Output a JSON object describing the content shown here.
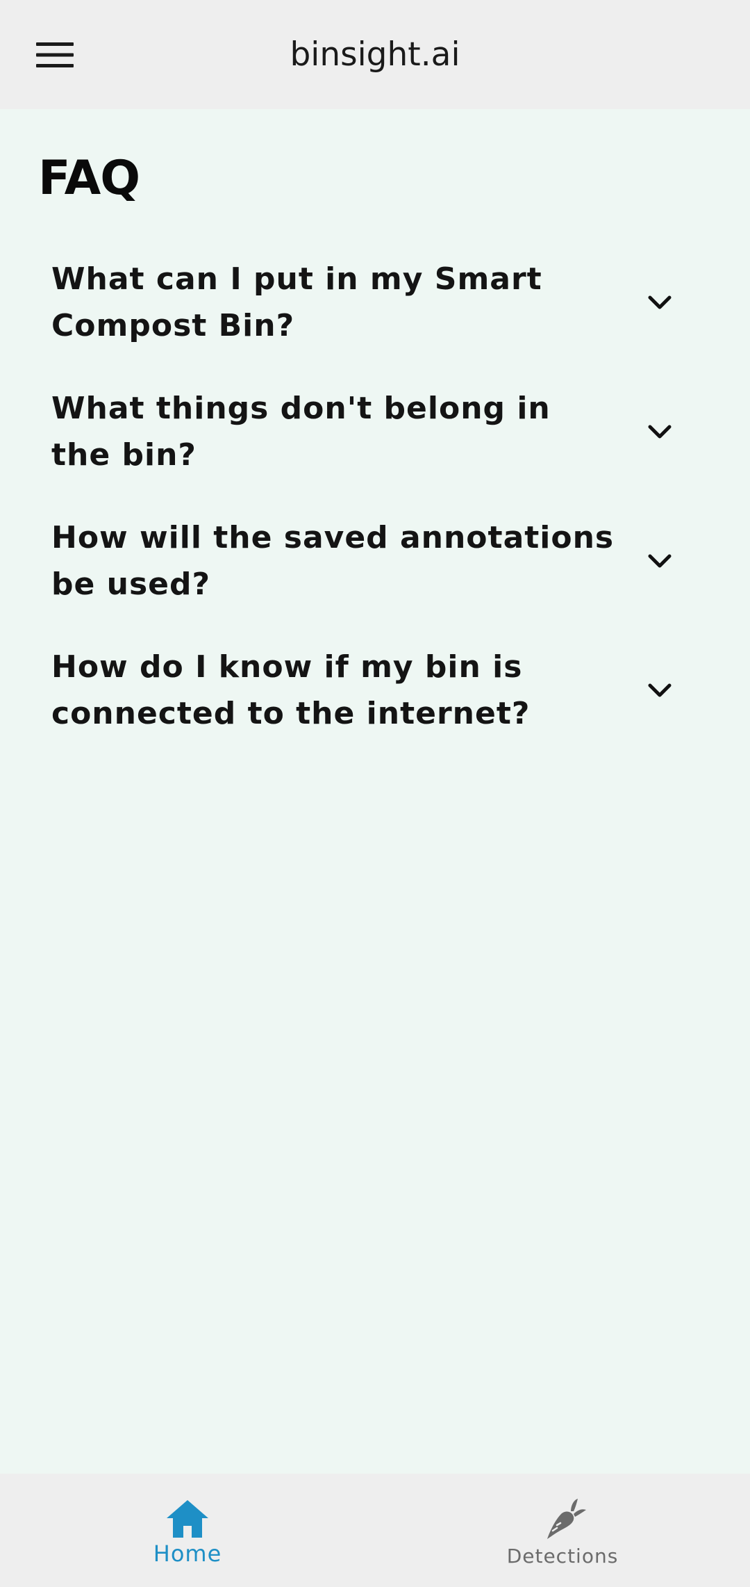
{
  "app_bar": {
    "title": "binsight.ai",
    "menu_icon": "hamburger-menu-icon"
  },
  "page": {
    "title": "FAQ"
  },
  "faq": {
    "items": [
      {
        "question": "What can I put in my Smart Compost Bin?",
        "icon": "chevron-down-icon"
      },
      {
        "question": "What things don't belong in the bin?",
        "icon": "chevron-down-icon"
      },
      {
        "question": "How will the saved annotations be used?",
        "icon": "chevron-down-icon"
      },
      {
        "question": "How do I know if my bin is connected to the internet?",
        "icon": "chevron-down-icon"
      }
    ]
  },
  "bottom_nav": {
    "items": [
      {
        "label": "Home",
        "icon": "home-icon",
        "active": true
      },
      {
        "label": "Detections",
        "icon": "carrot-icon",
        "active": false
      }
    ]
  },
  "colors": {
    "app_bar_background": "#eeeeee",
    "page_background": "#eef7f3",
    "active_tab": "#1e8fc6",
    "inactive_tab": "#6b6b6b"
  }
}
